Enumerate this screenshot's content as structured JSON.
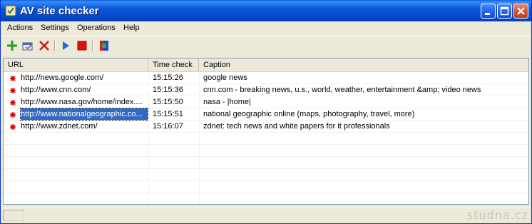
{
  "window": {
    "title": "AV site checker"
  },
  "menu": [
    "Actions",
    "Settings",
    "Operations",
    "Help"
  ],
  "toolbar": {
    "icons": [
      "add-icon",
      "edit-icon",
      "delete-icon",
      "play-icon",
      "stop-icon",
      "app-icon"
    ]
  },
  "list": {
    "columns": [
      "URL",
      "Time check",
      "Caption"
    ],
    "rows": [
      {
        "url": "http://news.google.com/",
        "time": "15:15:26",
        "caption": "google news"
      },
      {
        "url": "http://www.cnn.com/",
        "time": "15:15:36",
        "caption": "cnn.com - breaking news, u.s., world, weather, entertainment &amp; video news"
      },
      {
        "url": "http://www.nasa.gov/home/index....",
        "time": "15:15:50",
        "caption": "nasa - |home|"
      },
      {
        "url": "http://www.nationalgeographic.co...",
        "time": "15:15:51",
        "caption": "national geographic online (maps, photography, travel, more)",
        "selected": true
      },
      {
        "url": "http://www.zdnet.com/",
        "time": "15:16:07",
        "caption": "zdnet: tech news and white papers for it professionals"
      }
    ]
  },
  "status": {
    "watermark": "studna.cz"
  },
  "colors": {
    "title_bar": "#0b58d8",
    "selection": "#316ac5",
    "row_icon": "#cc0000"
  }
}
